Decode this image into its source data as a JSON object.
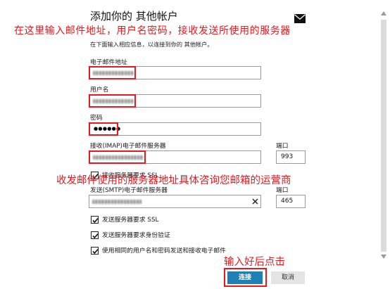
{
  "window": {
    "title": "添加你的 其他帐户",
    "title_icon": "mail-icon",
    "subtitle": "在下面输入相应信息，以连接到你的 其他帐户。"
  },
  "form": {
    "email": {
      "label": "电子邮件地址"
    },
    "username": {
      "label": "用户名"
    },
    "password": {
      "label": "密码",
      "value": "●●●●●●"
    },
    "incoming_server": {
      "label": "接收(IMAP)电子邮件服务器",
      "port_label": "端口",
      "port_value": "993"
    },
    "outgoing_server": {
      "label": "发送(SMTP)电子邮件服务器",
      "port_label": "端口",
      "port_value": "465",
      "clear_icon": "clear-icon"
    }
  },
  "checkboxes": [
    {
      "label": "接收服务器要求 SSL",
      "checked": true
    },
    {
      "label": "发送服务器要求 SSL",
      "checked": true
    },
    {
      "label": "发送服务器要求身份验证",
      "checked": true
    },
    {
      "label": "使用相同的用户名和密码发送和接收电子邮件",
      "checked": true
    }
  ],
  "buttons": {
    "connect": "连接",
    "cancel": "取消"
  },
  "annotations": {
    "top_note": "在这里输入邮件地址，用户名密码，接收发送所使用的服务器",
    "server_note": "收发邮件使用的服务器地址具体咨询您邮箱的运营商",
    "button_note": "输入好后点击"
  },
  "colors": {
    "annotation": "#e8191f",
    "highlight_box": "#e8191f",
    "accent_button": "#1f80b4",
    "cancel_button": "#e4e4e4"
  },
  "scrollbar": {
    "up_icon": "scroll-up-icon",
    "down_icon": "scroll-down-icon"
  }
}
